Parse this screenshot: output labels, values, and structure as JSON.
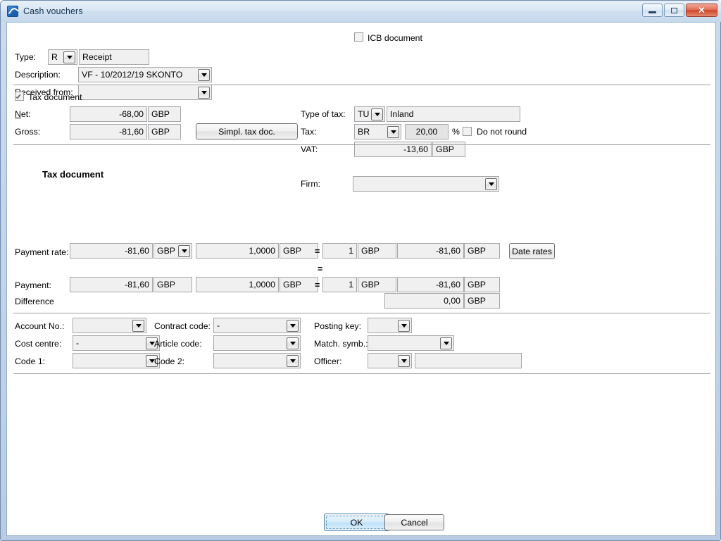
{
  "window": {
    "title": "Cash vouchers",
    "icon": "app-icon",
    "buttons": {
      "minimize": "minimize-icon",
      "maximize": "maximize-icon",
      "close": "✕"
    }
  },
  "header": {
    "type_label": "Type:",
    "type_code": "R",
    "type_name": "Receipt",
    "description_label": "Description:",
    "description_value": "VF - 10/2012/19 SKONTO",
    "received_from_label": "Received from:",
    "received_from_value": "",
    "icb_label": "ICB document",
    "icb_checked": false
  },
  "tax": {
    "tax_document_label": "Tax document",
    "tax_document_checked": true,
    "net_label": "Net:",
    "net_label_accel": "N",
    "net_label_rest": "et:",
    "net_value": "-68,00",
    "net_currency": "GBP",
    "gross_label": "Gross:",
    "gross_value": "-81,60",
    "gross_currency": "GBP",
    "simpl_button": "Simpl. tax doc.",
    "type_of_tax_label": "Type of tax:",
    "type_of_tax_code": "TU",
    "type_of_tax_name": "Inland",
    "tax_label": "Tax:",
    "tax_code": "BR",
    "tax_rate": "20,00",
    "percent_sign": "%",
    "do_not_round_label": "Do not round",
    "do_not_round_checked": false,
    "vat_label": "VAT:",
    "vat_value": "-13,60",
    "vat_currency": "GBP"
  },
  "document": {
    "heading": "Tax document",
    "firm_label": "Firm:",
    "firm_value": ""
  },
  "rates": {
    "payment_rate_label": "Payment rate:",
    "payment_rate_amount": "-81,60",
    "payment_rate_amount_currency": "GBP",
    "payment_rate_rate": "1,0000",
    "payment_rate_rate_currency": "GBP",
    "eq1": "=",
    "payment_rate_unit": "1",
    "payment_rate_unit_currency": "GBP",
    "payment_rate_total": "-81,60",
    "payment_rate_total_currency": "GBP",
    "date_rates_button": "Date rates",
    "eq2": "=",
    "payment_label": "Payment:",
    "payment_amount": "-81,60",
    "payment_amount_currency": "GBP",
    "payment_rate": "1,0000",
    "payment_rate_currency": "GBP",
    "eq3": "=",
    "payment_unit": "1",
    "payment_unit_currency": "GBP",
    "payment_total": "-81,60",
    "payment_total_currency": "GBP",
    "difference_label": "Difference",
    "difference_value": "0,00",
    "difference_currency": "GBP"
  },
  "codes": {
    "account_no_label": "Account No.:",
    "account_no_value": "",
    "cost_centre_label": "Cost centre:",
    "cost_centre_value": "-",
    "code1_label": "Code 1:",
    "code1_value": "",
    "contract_code_label": "Contract code:",
    "contract_code_value": "-",
    "article_code_label": "Article code:",
    "article_code_value": "",
    "code2_label": "Code 2:",
    "code2_value": "",
    "posting_key_label": "Posting key:",
    "posting_key_value": "",
    "match_symb_label": "Match. symb.:",
    "match_symb_value": "",
    "officer_label": "Officer:",
    "officer_code": "",
    "officer_name": ""
  },
  "footer": {
    "ok": "OK",
    "cancel": "Cancel"
  }
}
